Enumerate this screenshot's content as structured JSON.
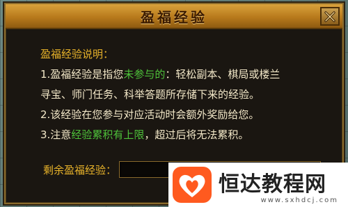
{
  "dialog": {
    "title": "盈福经验",
    "heading": "盈福经验说明：",
    "line1": {
      "prefix": "1.盈福经验是指您",
      "highlight": "未参与的",
      "suffix": "：轻松副本、棋局或楼兰"
    },
    "line1b": "寻宝、师门任务、科举答题所存储下来的经验。",
    "line2": "2.该经验在您参与对应活动时会额外奖励给您。",
    "line3": {
      "prefix": "3.注意",
      "highlight": "经验累积有上限",
      "suffix": "，超过后将无法累积。"
    },
    "remain_label": "剩余盈福经验：",
    "remain_value": ""
  },
  "watermark": {
    "text": "恒达教程网",
    "url": "www.sxhdcj.com"
  },
  "colors": {
    "heading": "#e8b32a",
    "highlight": "#4ec23a",
    "body_text": "#f3e8c8",
    "title_bar": "#c88a26"
  },
  "icons": {
    "close": "close-icon",
    "watermark_logo": "heart-logo-icon"
  }
}
